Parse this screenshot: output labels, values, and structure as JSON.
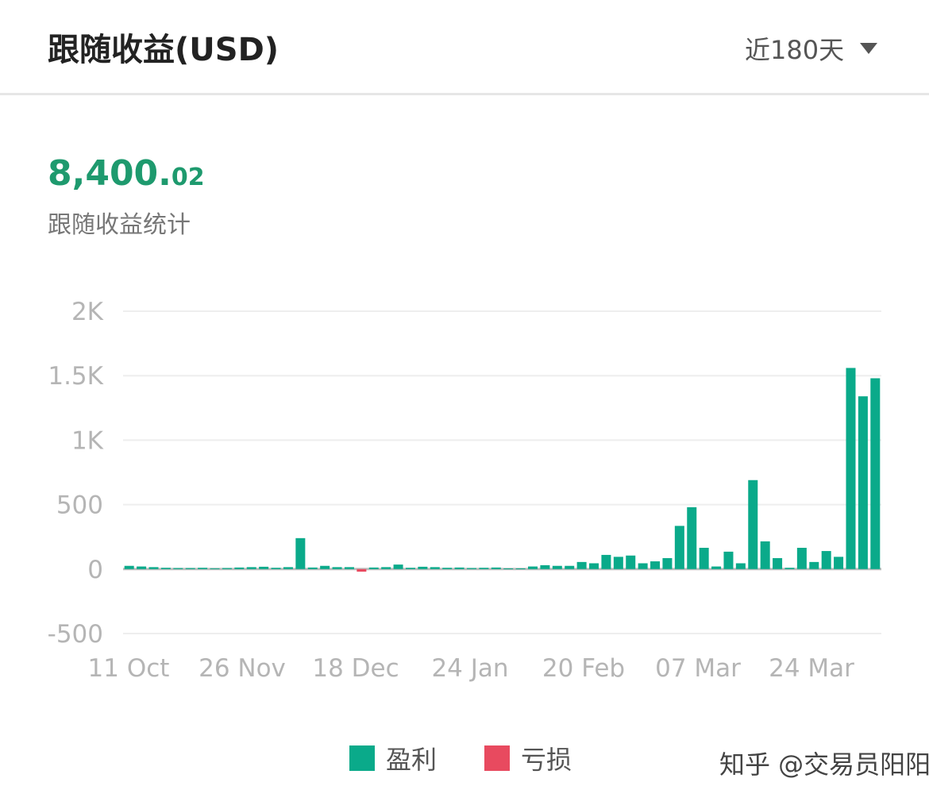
{
  "header": {
    "title": "跟随收益(USD)",
    "range_label": "近180天"
  },
  "summary": {
    "total_int": "8,400.",
    "total_dec": "02",
    "label": "跟随收益统计"
  },
  "colors": {
    "profit": "#0aaa8a",
    "loss": "#e84a5f",
    "total": "#1e9a6e"
  },
  "legend": {
    "profit_label": "盈利",
    "loss_label": "亏损"
  },
  "watermark": "知乎 @交易员阳阳",
  "chart_data": {
    "type": "bar",
    "title": "",
    "xlabel": "",
    "ylabel": "",
    "ylim": [
      -500,
      2000
    ],
    "yticks": [
      {
        "value": 2000,
        "label": "2K"
      },
      {
        "value": 1500,
        "label": "1.5K"
      },
      {
        "value": 1000,
        "label": "1K"
      },
      {
        "value": 500,
        "label": "500"
      },
      {
        "value": 0,
        "label": "0"
      },
      {
        "value": -500,
        "label": "-500"
      }
    ],
    "xtick_labels": [
      "11 Oct",
      "26 Nov",
      "18 Dec",
      "24 Jan",
      "20 Feb",
      "07 Mar",
      "24 Mar"
    ],
    "grid": true,
    "legend_position": "bottom-center",
    "series": [
      {
        "name": "盈利"
      },
      {
        "name": "亏损"
      }
    ],
    "values": [
      25,
      20,
      15,
      10,
      8,
      8,
      10,
      6,
      8,
      12,
      15,
      18,
      10,
      15,
      240,
      12,
      25,
      15,
      15,
      -20,
      12,
      15,
      35,
      10,
      18,
      15,
      10,
      12,
      8,
      10,
      12,
      5,
      5,
      20,
      30,
      25,
      25,
      55,
      45,
      110,
      95,
      105,
      45,
      60,
      85,
      335,
      480,
      165,
      20,
      135,
      45,
      690,
      215,
      85,
      10,
      165,
      55,
      140,
      95,
      1560,
      1340,
      1480
    ]
  }
}
